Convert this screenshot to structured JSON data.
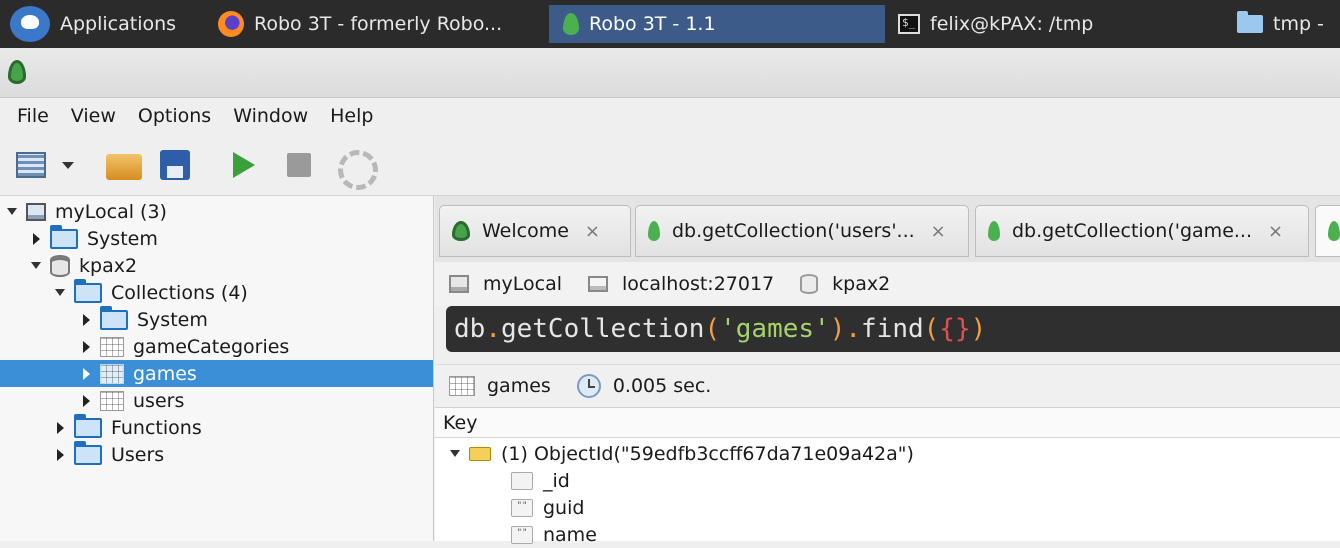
{
  "taskbar": {
    "items": [
      {
        "label": "Applications",
        "icon": "xfce-mouse-icon",
        "active": false
      },
      {
        "label": "Robo 3T - formerly Robo...",
        "icon": "firefox-icon",
        "active": false
      },
      {
        "label": "Robo 3T - 1.1",
        "icon": "robo3t-leaf-icon",
        "active": true
      },
      {
        "label": "felix@kPAX: /tmp",
        "icon": "terminal-icon",
        "active": false
      },
      {
        "label": "tmp -",
        "icon": "folder-icon",
        "active": false
      }
    ]
  },
  "menubar": {
    "items": [
      "File",
      "View",
      "Options",
      "Window",
      "Help"
    ]
  },
  "toolbar": {
    "buttons": [
      "connect-icon",
      "open-folder-icon",
      "save-icon",
      "execute-icon",
      "stop-icon",
      "refresh-icon"
    ]
  },
  "tree": {
    "connection": "myLocal (3)",
    "system": "System",
    "database": "kpax2",
    "collections": "Collections (4)",
    "collections_system": "System",
    "items": [
      "gameCategories",
      "games",
      "users"
    ],
    "functions": "Functions",
    "users": "Users",
    "selected": "games"
  },
  "tabs": [
    {
      "label": "Welcome",
      "close": "×"
    },
    {
      "label": "db.getCollection('users'...",
      "close": "×"
    },
    {
      "label": "db.getCollection('game...",
      "close": "×"
    }
  ],
  "infobar": {
    "connection": "myLocal",
    "host": "localhost:27017",
    "database": "kpax2"
  },
  "editor": {
    "query_db": "db",
    "query_dot1": ".",
    "query_fn1": "getCollection",
    "query_paren_open": "(",
    "query_str": "'games'",
    "query_paren_close": ")",
    "query_dot2": ".",
    "query_fn2": "find",
    "query_paren_open2": "(",
    "query_brace": "{}",
    "query_paren_close2": ")"
  },
  "resultbar": {
    "collection": "games",
    "time": "0.005 sec."
  },
  "results": {
    "column_header": "Key",
    "document": "(1) ObjectId(\"59edfb3ccff67da71e09a42a\")",
    "fields": [
      {
        "name": "_id",
        "type_icon": ""
      },
      {
        "name": "guid",
        "type_icon": "\"\""
      },
      {
        "name": "name",
        "type_icon": "\"\""
      }
    ]
  },
  "colors": {
    "selection": "#3a8fd6",
    "editor_bg": "#2f2f2f",
    "taskbar_bg": "#2b2b2b",
    "active_task": "#3c5b89"
  }
}
